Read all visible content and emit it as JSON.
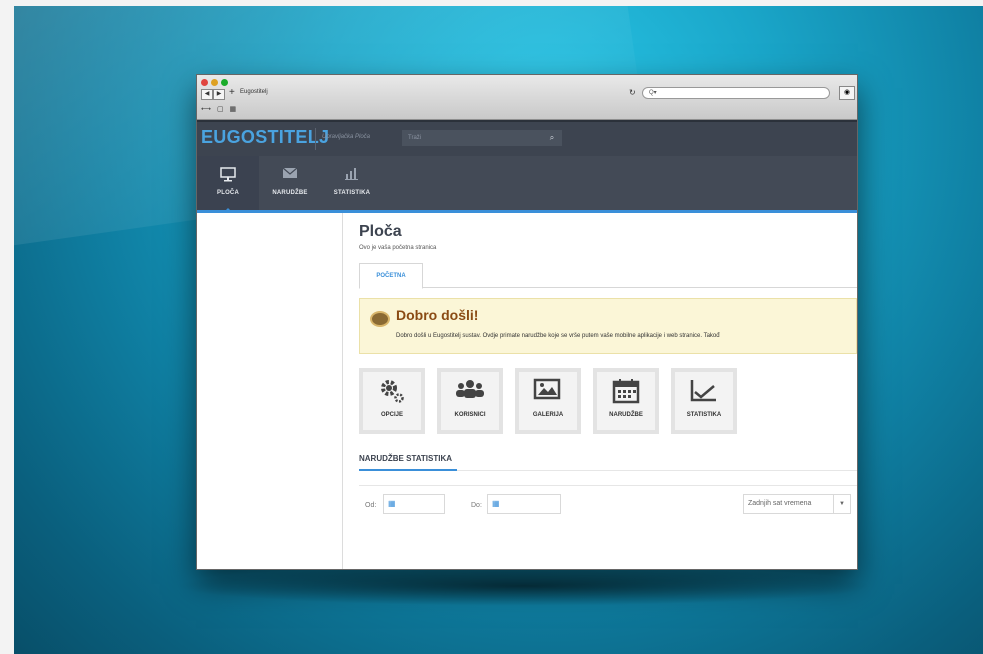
{
  "browser": {
    "tab_title": "Eugostitelj",
    "search_placeholder": "Q▾"
  },
  "app": {
    "brand": "EUGOSTITELJ",
    "brand_sub": "Upravljačka Ploča",
    "search_placeholder": "Traži"
  },
  "nav": [
    {
      "label": "PLOČA",
      "icon": "monitor-icon"
    },
    {
      "label": "NARUDŽBE",
      "icon": "envelope-icon"
    },
    {
      "label": "STATISTIKA",
      "icon": "bar-chart-icon"
    }
  ],
  "page": {
    "title": "Ploča",
    "subtitle": "Ovo je vaša početna stranica",
    "tab": "POČETNA"
  },
  "welcome": {
    "title": "Dobro došli!",
    "text": "Dobro došli u Eugostitelj sustav. Ovdje primate narudžbe koje se vrše putem vaše mobilne aplikacije i web stranice. Takođ"
  },
  "shortcuts": [
    {
      "label": "OPCIJE",
      "icon": "gears-icon"
    },
    {
      "label": "KORISNICI",
      "icon": "users-icon"
    },
    {
      "label": "GALERIJA",
      "icon": "image-icon"
    },
    {
      "label": "NARUDŽBE",
      "icon": "calendar-icon"
    },
    {
      "label": "STATISTIKA",
      "icon": "line-chart-icon"
    }
  ],
  "stats": {
    "title": "NARUDŽBE STATISTIKA",
    "from_label": "Od:",
    "to_label": "Do:",
    "range": "Zadnjih sat vremena"
  },
  "colors": {
    "accent": "#3a8fd9",
    "header": "#3d4450",
    "welcome_bg": "#fbf6d7"
  }
}
